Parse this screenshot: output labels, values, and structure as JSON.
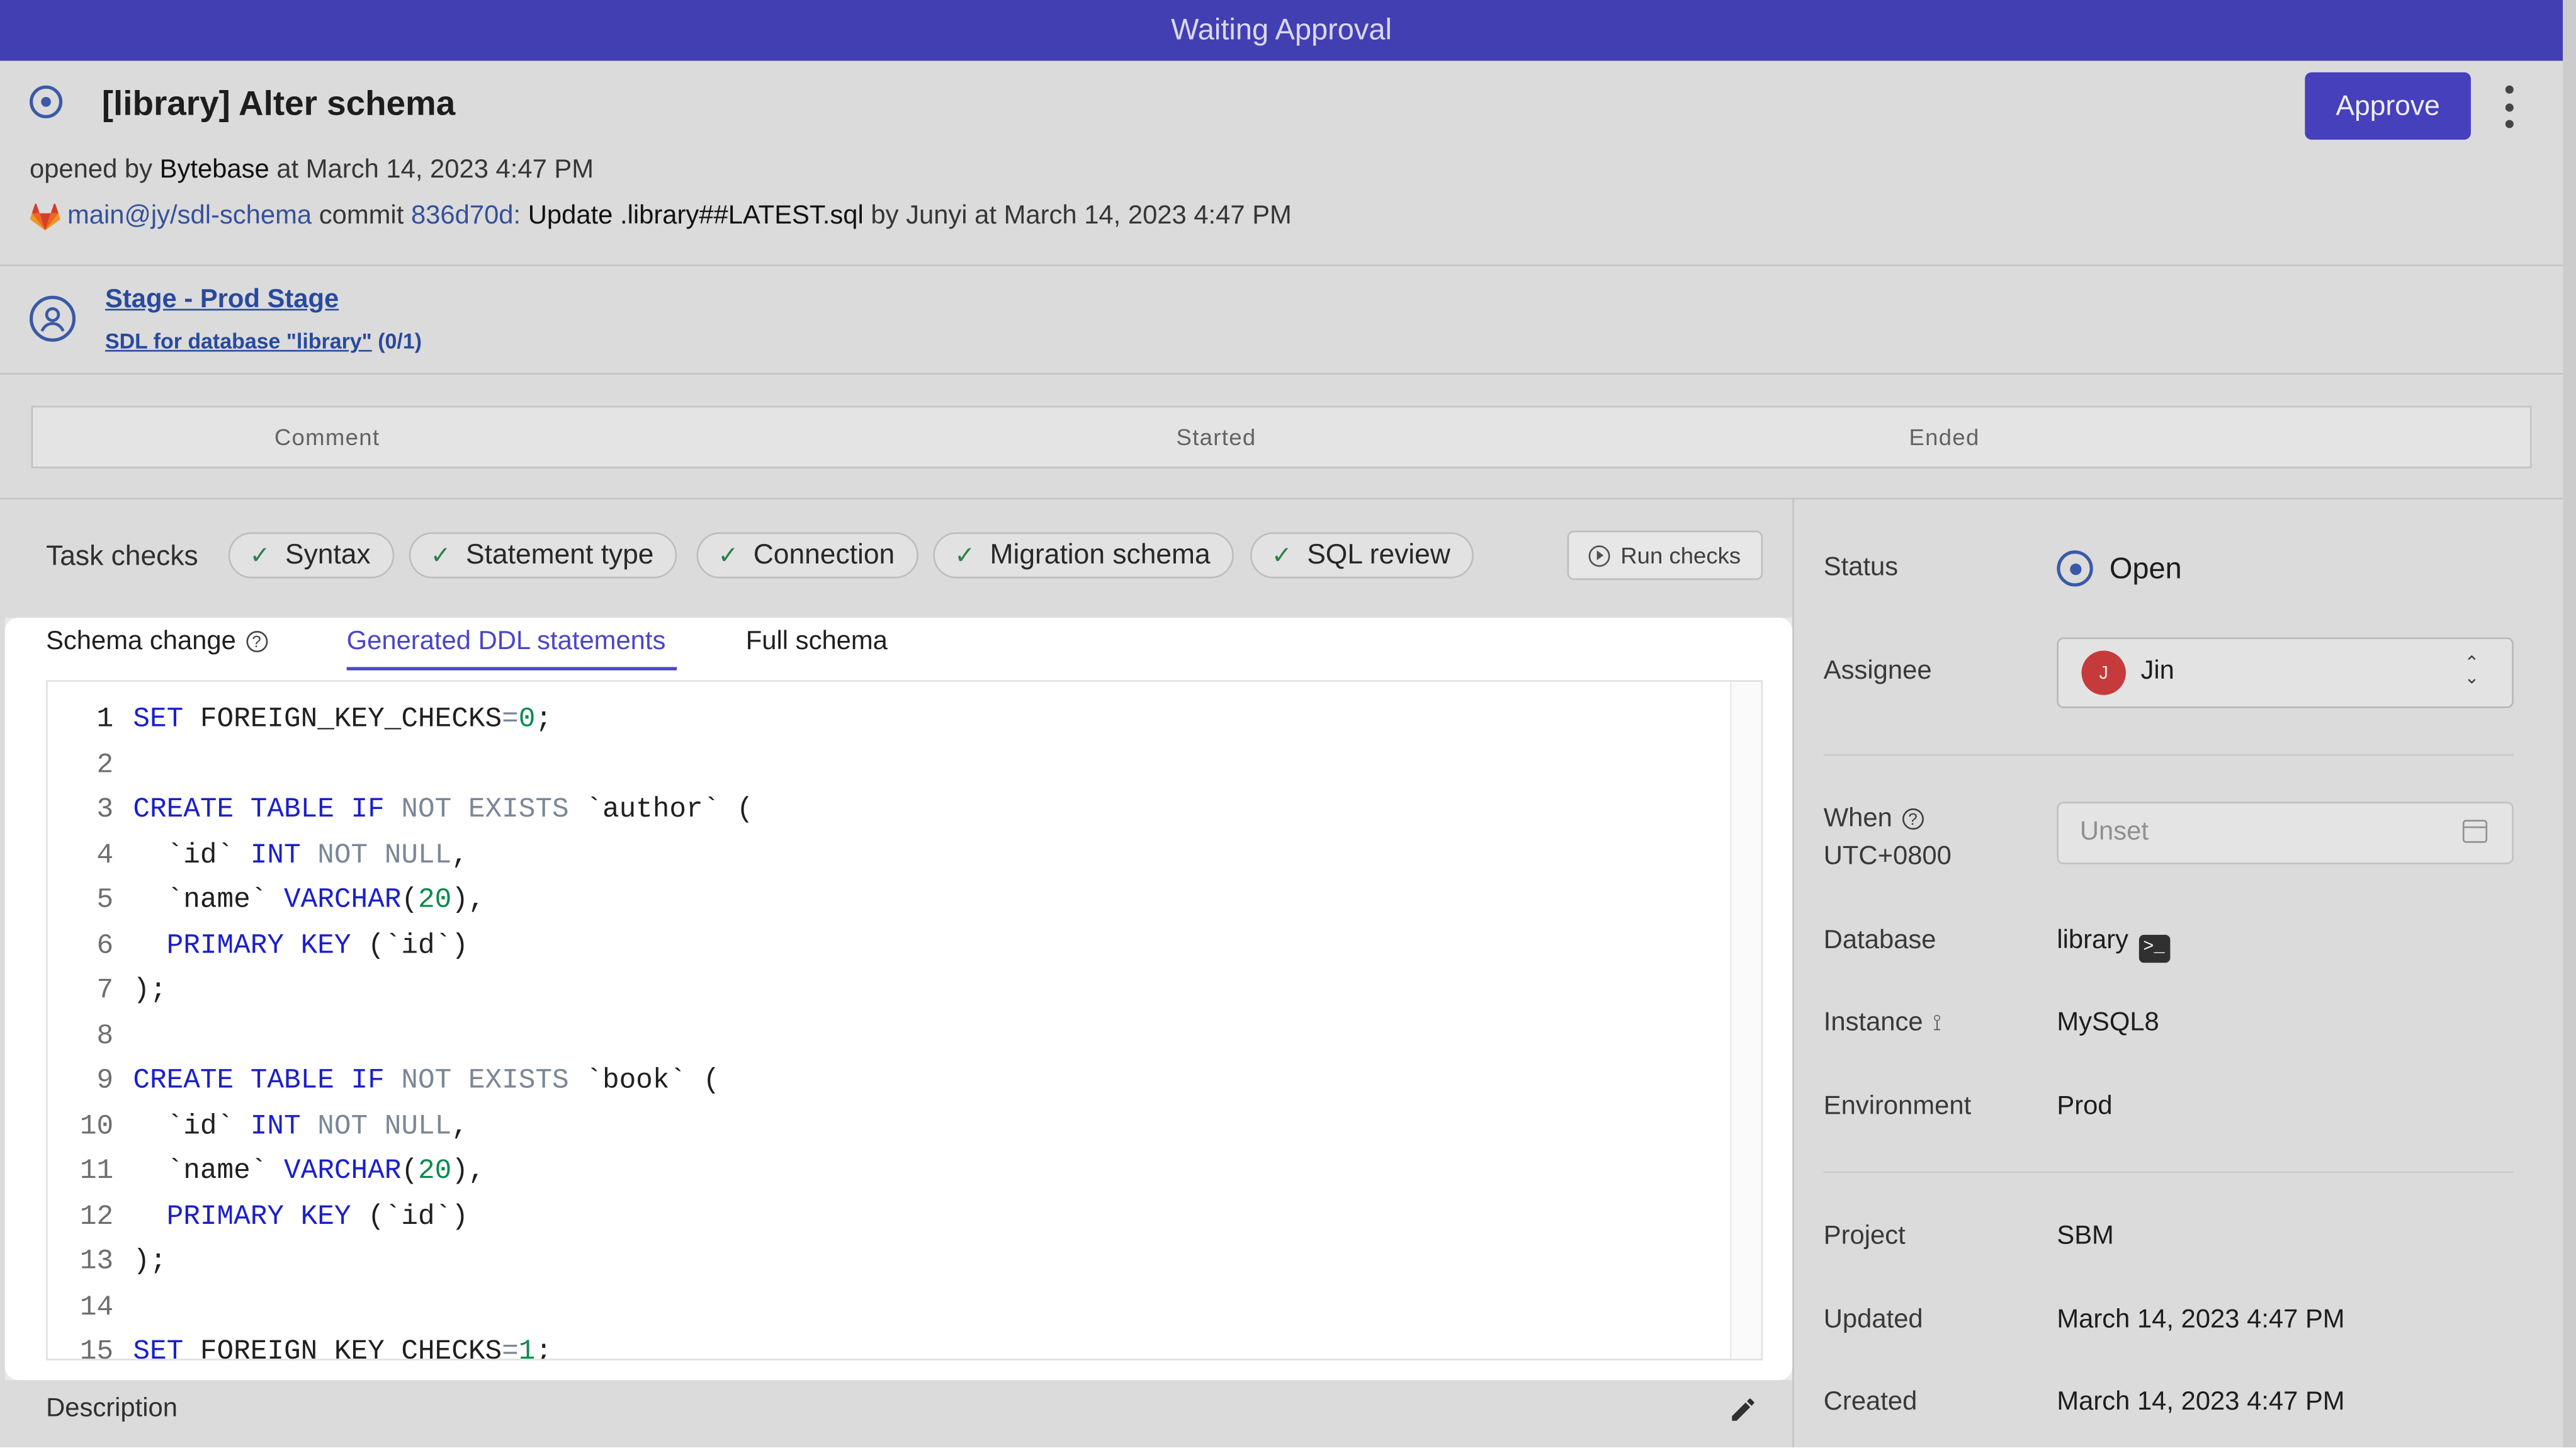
{
  "banner": {
    "text": "Waiting Approval"
  },
  "header": {
    "title": "[library] Alter schema",
    "approve_label": "Approve",
    "opened_prefix": "opened by",
    "opened_by": "Bytebase",
    "opened_at": "at March 14, 2023 4:47 PM",
    "branch": "main@jy/sdl-schema",
    "commit_word": "commit",
    "commit_hash": "836d70d:",
    "commit_message": "Update .library##LATEST.sql",
    "commit_by": "by Junyi at March 14, 2023 4:47 PM"
  },
  "stage": {
    "title": "Stage - Prod Stage",
    "task": "SDL for database \"library\"",
    "task_count": "(0/1)"
  },
  "task_table": {
    "headers": [
      "Comment",
      "Started",
      "Ended"
    ]
  },
  "checks": {
    "label": "Task checks",
    "items": [
      "Syntax",
      "Statement type",
      "Connection",
      "Migration schema",
      "SQL review"
    ],
    "run_label": "Run checks"
  },
  "tabs": [
    "Schema change",
    "Generated DDL statements",
    "Full schema"
  ],
  "active_tab": "Generated DDL statements",
  "code_lines": [
    "SET FOREIGN_KEY_CHECKS=0;",
    "",
    "CREATE TABLE IF NOT EXISTS `author` (",
    "  `id` INT NOT NULL,",
    "  `name` VARCHAR(20),",
    "  PRIMARY KEY (`id`)",
    ");",
    "",
    "CREATE TABLE IF NOT EXISTS `book` (",
    "  `id` INT NOT NULL,",
    "  `name` VARCHAR(20),",
    "  PRIMARY KEY (`id`)",
    ");",
    "",
    "SET FOREIGN_KEY_CHECKS=1;"
  ],
  "description_label": "Description",
  "sidebar": {
    "status_label": "Status",
    "status_value": "Open",
    "assignee_label": "Assignee",
    "assignee_initial": "J",
    "assignee_name": "Jin",
    "when_label": "When",
    "when_tz": "UTC+0800",
    "when_placeholder": "Unset",
    "database_label": "Database",
    "database_value": "library",
    "instance_label": "Instance",
    "instance_value": "MySQL8",
    "environment_label": "Environment",
    "environment_value": "Prod",
    "project_label": "Project",
    "project_value": "SBM",
    "updated_label": "Updated",
    "updated_value": "March 14, 2023 4:47 PM",
    "created_label": "Created",
    "created_value": "March 14, 2023 4:47 PM"
  },
  "colors": {
    "accent": "#4b45c9",
    "banner": "#4743bf",
    "keyword": "#1a1fcc",
    "number": "#0c8a4f"
  }
}
